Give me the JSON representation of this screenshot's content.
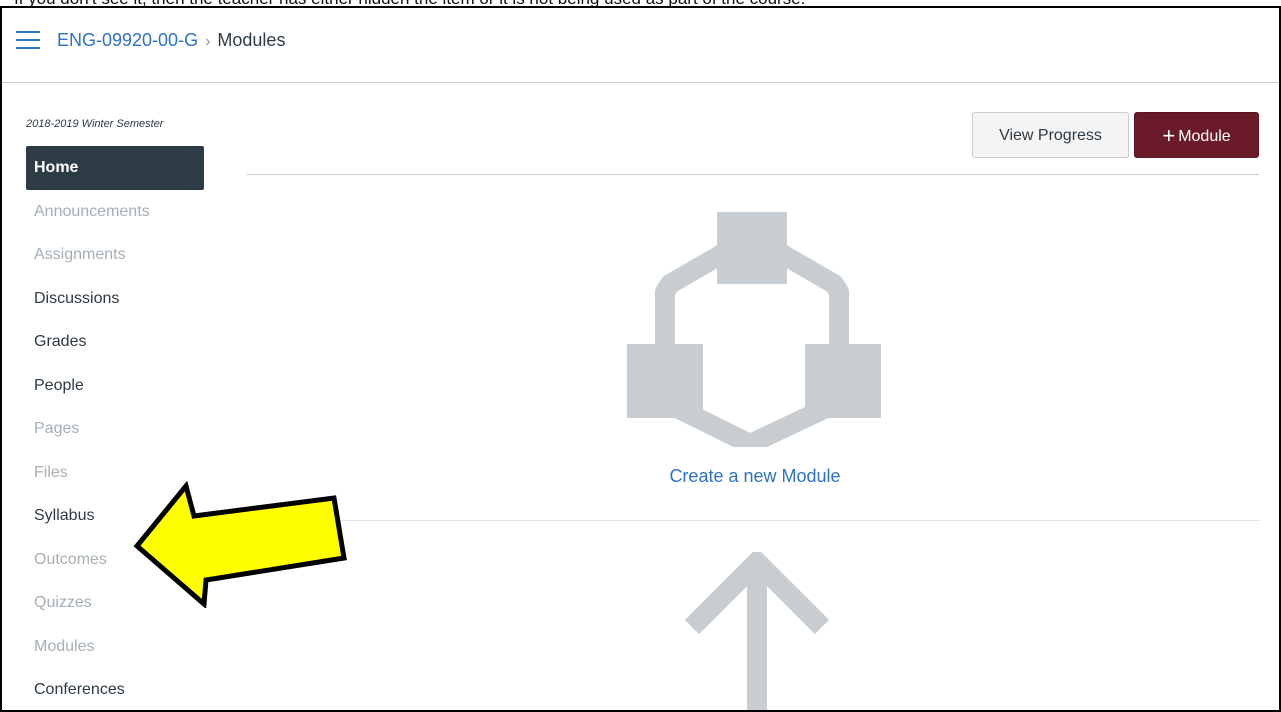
{
  "cutoff_caption": "If you don't see it, then the teacher has either hidden the item or it is not being used as part of the course.",
  "header": {
    "course_code": "ENG-09920-00-G",
    "separator": "›",
    "current_page": "Modules"
  },
  "sidebar": {
    "term": "2018-2019 Winter Semester",
    "items": [
      {
        "label": "Home",
        "state": "active"
      },
      {
        "label": "Announcements",
        "state": "disabled"
      },
      {
        "label": "Assignments",
        "state": "disabled"
      },
      {
        "label": "Discussions",
        "state": "enabled"
      },
      {
        "label": "Grades",
        "state": "enabled"
      },
      {
        "label": "People",
        "state": "enabled"
      },
      {
        "label": "Pages",
        "state": "disabled"
      },
      {
        "label": "Files",
        "state": "disabled"
      },
      {
        "label": "Syllabus",
        "state": "enabled"
      },
      {
        "label": "Outcomes",
        "state": "disabled"
      },
      {
        "label": "Quizzes",
        "state": "disabled"
      },
      {
        "label": "Modules",
        "state": "disabled"
      },
      {
        "label": "Conferences",
        "state": "enabled"
      }
    ]
  },
  "toolbar": {
    "view_progress_label": "View Progress",
    "add_module_plus": "+",
    "add_module_label": "Module"
  },
  "empty_state": {
    "create_link": "Create a new Module"
  },
  "colors": {
    "link": "#2d72c4",
    "nav_active_bg": "#2d3b45",
    "primary_button": "#6b1a2a",
    "annotation_arrow": "#ffff00",
    "graphic_gray": "#c7cdd1"
  }
}
